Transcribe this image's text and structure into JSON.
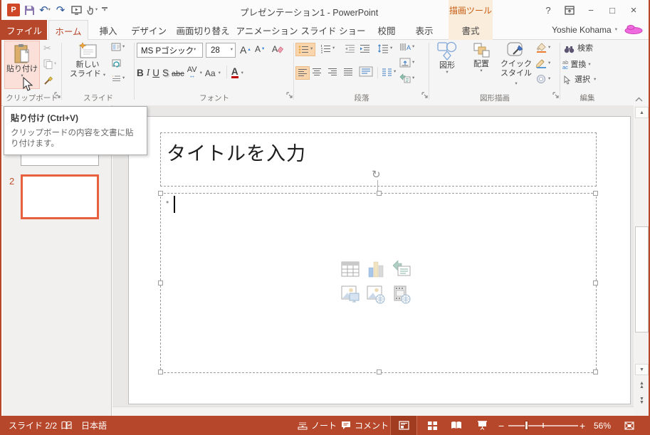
{
  "glyphs": {
    "caret": "▾",
    "tri_up": "▲",
    "tri_down": "▼",
    "tri_up_s": "▴",
    "tri_down_s": "▾",
    "scissors": "✂",
    "undo": "↶",
    "redo": "↷",
    "rotate": "↻",
    "help": "?",
    "minimize": "−",
    "maximize": "□",
    "close": "×",
    "bullet": "•",
    "harrow": "↔",
    "minus": "−",
    "plus": "+",
    "ab": "ab",
    "ac": "ac"
  },
  "titlebar": {
    "title": "プレゼンテーション1 - PowerPoint",
    "contextual_group": "描画ツール",
    "user_name": "Yoshie Kohama"
  },
  "tabs": {
    "file": "ファイル",
    "home": "ホーム",
    "insert": "挿入",
    "design": "デザイン",
    "transitions": "画面切り替え",
    "animations": "アニメーション",
    "slideshow": "スライド ショー",
    "review": "校閲",
    "view": "表示",
    "format": "書式"
  },
  "ribbon": {
    "clipboard": {
      "label": "クリップボード",
      "paste": "貼り付け"
    },
    "slides": {
      "label": "スライド",
      "ns1": "新しい",
      "ns2": "スライド"
    },
    "font": {
      "label": "フォント",
      "name": "MS Pゴシック 本文",
      "size": "28",
      "bold": "B",
      "italic": "I",
      "underline": "U",
      "shadow": "S",
      "strike": "abc",
      "spacing": "AV",
      "case": "Aa",
      "color": "A",
      "grow": "A",
      "shrink": "A",
      "clear": "A"
    },
    "paragraph": {
      "label": "段落"
    },
    "drawing": {
      "label": "図形描画",
      "shapes": "図形",
      "arrange": "配置",
      "qs1": "クイック",
      "qs2": "スタイル"
    },
    "editing": {
      "label": "編集",
      "find": "検索",
      "replace": "置換",
      "select": "選択"
    }
  },
  "tooltip": {
    "title": "貼り付け (Ctrl+V)",
    "body": "クリップボードの内容を文書に貼り付けます。"
  },
  "panel": {
    "slide2_number": "2"
  },
  "slide": {
    "title_placeholder": "タイトルを入力"
  },
  "statusbar": {
    "slide": "スライド 2/2",
    "lang": "日本語",
    "notes": "ノート",
    "comments": "コメント",
    "zoom": "56%"
  }
}
